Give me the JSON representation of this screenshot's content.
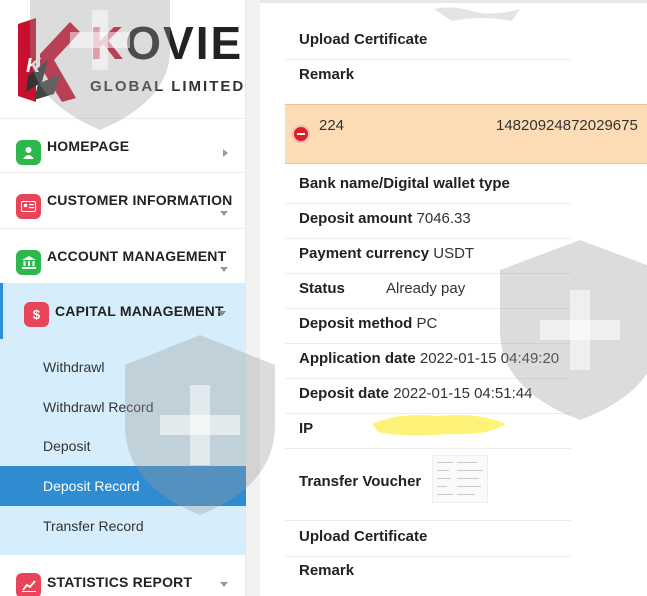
{
  "brand": {
    "name_red": "K",
    "name_rest": "OVIE",
    "subtitle": "GLOBAL LIMITED"
  },
  "sidebar": {
    "items": [
      {
        "label": "HOMEPAGE",
        "icon": "user-icon",
        "color": "#2db84d"
      },
      {
        "label": "CUSTOMER INFORMATION",
        "icon": "id-card-icon",
        "color": "#e8455a"
      },
      {
        "label": "ACCOUNT MANAGEMENT",
        "icon": "bank-icon",
        "color": "#2db84d"
      },
      {
        "label": "CAPITAL MANAGEMENT",
        "icon": "dollar-icon",
        "color": "#e8455a"
      },
      {
        "label": "STATISTICS REPORT",
        "icon": "chart-icon",
        "color": "#e8455a"
      }
    ],
    "capital_sub": [
      {
        "label": "Withdrawl"
      },
      {
        "label": "Withdrawl Record"
      },
      {
        "label": "Deposit"
      },
      {
        "label": "Deposit Record"
      },
      {
        "label": "Transfer Record"
      }
    ],
    "accent": "#2f8cd1"
  },
  "record_top": {
    "upload_label": "Upload Certificate",
    "remark_label": "Remark"
  },
  "record": {
    "number": "224",
    "order_id": "14820924872029675",
    "bank_label": "Bank name/Digital wallet type",
    "bank_value": "",
    "amount_label": "Deposit amount",
    "amount_value": "7046.33",
    "currency_label": "Payment currency",
    "currency_value": "USDT",
    "status_label": "Status",
    "status_value": "Already pay",
    "method_label": "Deposit method",
    "method_value": "PC",
    "app_date_label": "Application date",
    "app_date_value": "2022-01-15 04:49:20",
    "dep_date_label": "Deposit date",
    "dep_date_value": "2022-01-15 04:51:44",
    "ip_label": "IP",
    "voucher_label": "Transfer Voucher",
    "upload_label": "Upload Certificate",
    "remark_label": "Remark"
  },
  "colors": {
    "highlight_bg": "#fbdcb4",
    "minus_btn": "#e02020",
    "redaction": "#fff16a"
  }
}
